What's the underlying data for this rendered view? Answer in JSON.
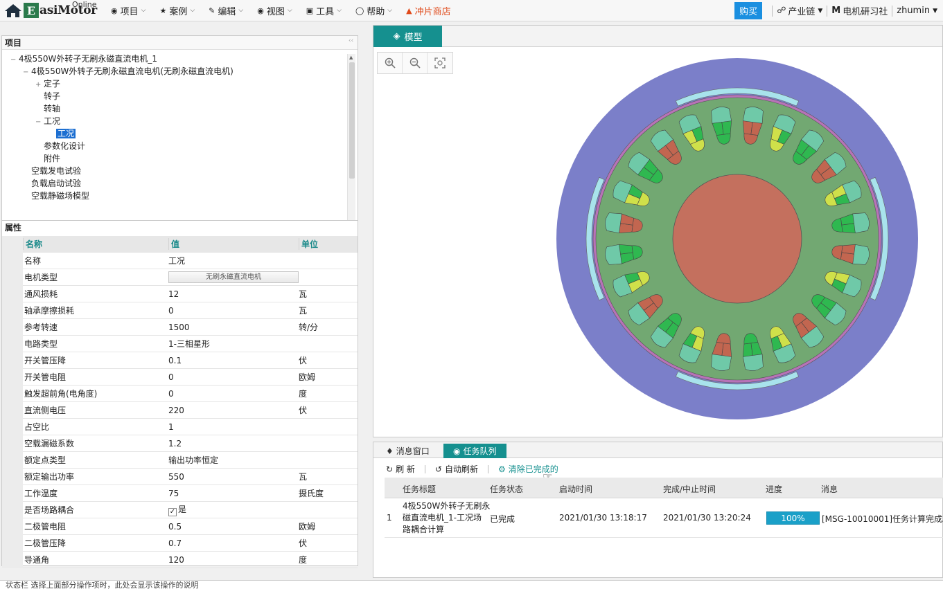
{
  "app": {
    "brand": "asiMotor",
    "brand_initial": "E",
    "brand_suffix": "Online"
  },
  "nav": [
    {
      "icon": "cube-icon",
      "label": "项目"
    },
    {
      "icon": "star-icon",
      "label": "案例"
    },
    {
      "icon": "edit-icon",
      "label": "编辑"
    },
    {
      "icon": "eye-icon",
      "label": "视图"
    },
    {
      "icon": "toolbox-icon",
      "label": "工具"
    },
    {
      "icon": "lightbulb-icon",
      "label": "帮助"
    }
  ],
  "shop_label": "冲片商店",
  "right_nav": {
    "buy": "购买",
    "chain": "产业链",
    "community": "电机研习社",
    "user": "zhumin"
  },
  "project_panel": {
    "title": "项目",
    "tree": [
      {
        "label": "4极550W外转子无刷永磁直流电机_1",
        "toggle": "−",
        "level": 0
      },
      {
        "label": "4极550W外转子无刷永磁直流电机(无刷永磁直流电机)",
        "toggle": "−",
        "level": 1
      },
      {
        "label": "定子",
        "toggle": "+",
        "level": 2
      },
      {
        "label": "转子",
        "toggle": "",
        "level": 2
      },
      {
        "label": "转轴",
        "toggle": "",
        "level": 2
      },
      {
        "label": "工况",
        "toggle": "−",
        "level": 2
      },
      {
        "label": "工况",
        "toggle": "",
        "level": 3,
        "selected": true
      },
      {
        "label": "参数化设计",
        "toggle": "",
        "level": 2
      },
      {
        "label": "附件",
        "toggle": "",
        "level": 2
      },
      {
        "label": "空载发电试验",
        "toggle": "",
        "level": 1
      },
      {
        "label": "负载启动试验",
        "toggle": "",
        "level": 1
      },
      {
        "label": "空载静磁场模型",
        "toggle": "",
        "level": 1
      }
    ]
  },
  "props_panel": {
    "title": "属性",
    "headers": {
      "name": "名称",
      "value": "值",
      "unit": "单位"
    },
    "rows": [
      {
        "name": "名称",
        "value": "工况",
        "unit": ""
      },
      {
        "name": "电机类型",
        "value": "无刷永磁直流电机",
        "unit": "",
        "button": true
      },
      {
        "name": "通风损耗",
        "value": "12",
        "unit": "瓦"
      },
      {
        "name": "轴承摩擦损耗",
        "value": "0",
        "unit": "瓦"
      },
      {
        "name": "参考转速",
        "value": "1500",
        "unit": "转/分"
      },
      {
        "name": "电路类型",
        "value": "1-三相星形",
        "unit": ""
      },
      {
        "name": "开关管压降",
        "value": "0.1",
        "unit": "伏"
      },
      {
        "name": "开关管电阻",
        "value": "0",
        "unit": "欧姆"
      },
      {
        "name": "触发超前角(电角度)",
        "value": "0",
        "unit": "度"
      },
      {
        "name": "直流侧电压",
        "value": "220",
        "unit": "伏"
      },
      {
        "name": "占空比",
        "value": "1",
        "unit": ""
      },
      {
        "name": "空载漏磁系数",
        "value": "1.2",
        "unit": ""
      },
      {
        "name": "额定点类型",
        "value": "输出功率恒定",
        "unit": ""
      },
      {
        "name": "额定输出功率",
        "value": "550",
        "unit": "瓦"
      },
      {
        "name": "工作温度",
        "value": "75",
        "unit": "摄氏度"
      },
      {
        "name": "是否场路耦合",
        "value": "是",
        "unit": "",
        "checkbox": true
      },
      {
        "name": "二极管电阻",
        "value": "0.5",
        "unit": "欧姆"
      },
      {
        "name": "二极管压降",
        "value": "0.7",
        "unit": "伏"
      },
      {
        "name": "导通角",
        "value": "120",
        "unit": "度"
      }
    ]
  },
  "model_panel": {
    "tab_label": "模型",
    "colors": {
      "outer_ring": "#7b7fc9",
      "magnet": "#a8e3ec",
      "air_ring": "#b773b7",
      "stator": "#72a872",
      "shaft": "#c4705e",
      "coil_teal": "#6fc9a8",
      "coil_red": "#c26650",
      "coil_yellow": "#cfe04a",
      "coil_green": "#2fb850"
    }
  },
  "task_panel": {
    "tabs": [
      "消息窗口",
      "任务队列"
    ],
    "toolbar": {
      "refresh": "刷 新",
      "auto_refresh": "自动刷新",
      "clear_done": "清除已完成的"
    },
    "headers": [
      "任务标题",
      "任务状态",
      "启动时间",
      "完成/中止时间",
      "进度",
      "消息"
    ],
    "rows": [
      {
        "index": "1",
        "title": "4极550W外转子无刷永磁直流电机_1-工况场路耦合计算",
        "title_lines": [
          "4极550W外转子无刷永",
          "磁直流电机_1-工况场",
          "路耦合计算"
        ],
        "status": "已完成",
        "start": "2021/01/30 13:18:17",
        "end": "2021/01/30 13:20:24",
        "progress_label": "100%",
        "progress": 1.0,
        "message": "[MSG-10010001]任务计算完成。"
      }
    ]
  },
  "statusbar": {
    "text": "状态栏    选择上面部分操作项时，此处会显示该操作的说明"
  }
}
